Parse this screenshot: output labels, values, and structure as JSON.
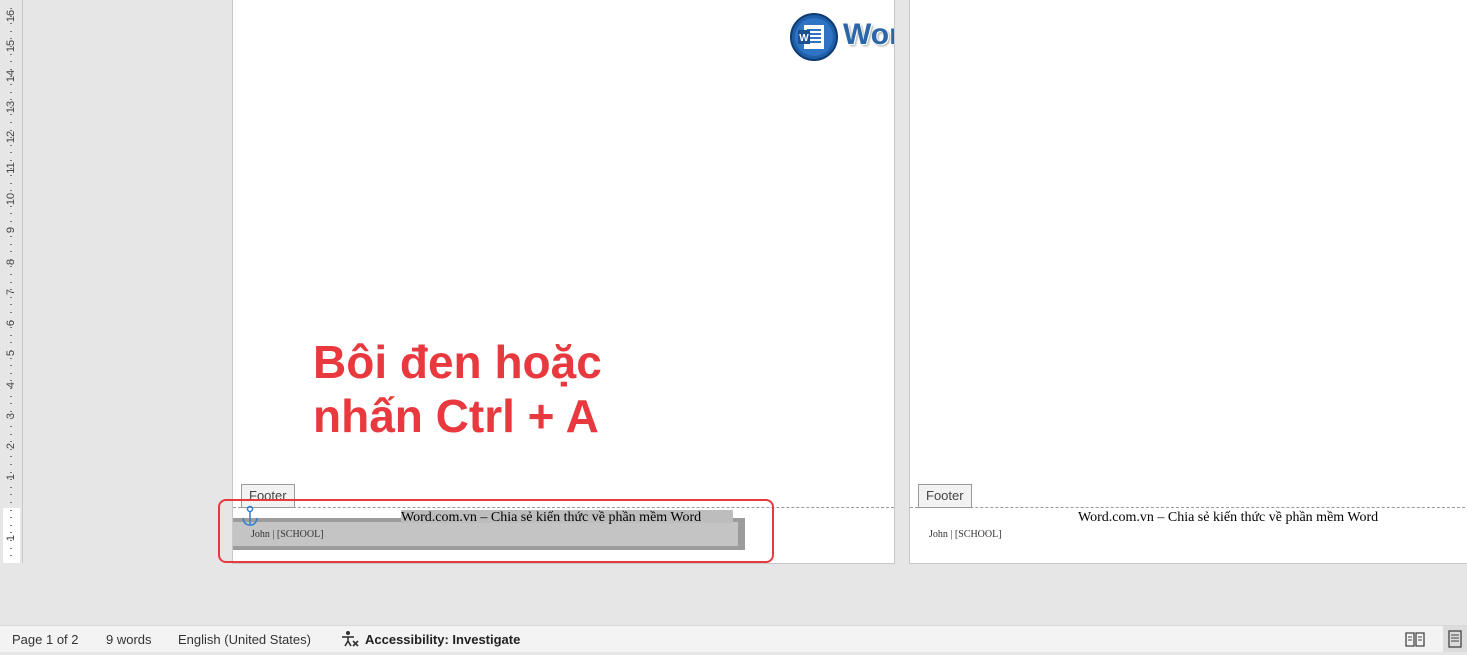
{
  "ruler": {
    "numbers": [
      "16",
      "15",
      "14",
      "13",
      "12",
      "11",
      "10",
      "9",
      "8",
      "7",
      "6",
      "5",
      "4",
      "3",
      "2",
      "1",
      "1"
    ]
  },
  "page1": {
    "footer_label": "Footer",
    "footer_text": "Word.com.vn – Chia sẻ kiến thức về phần mềm Word",
    "footer_name": "John | [SCHOOL]"
  },
  "page2": {
    "footer_label": "Footer",
    "footer_text": "Word.com.vn – Chia sẻ kiến thức về phần mềm Word",
    "footer_name": "John | [SCHOOL]"
  },
  "logo": {
    "text": "Word.com.vn"
  },
  "annotation": {
    "line1": "Bôi đen hoặc",
    "line2": "nhấn Ctrl + A"
  },
  "statusbar": {
    "page": "Page 1 of 2",
    "words": "9 words",
    "language": "English (United States)",
    "accessibility": "Accessibility: Investigate"
  },
  "icons": {
    "anchor": "anchor-icon",
    "accessibility": "accessibility-icon",
    "read_mode": "read-mode-icon",
    "print_layout": "print-layout-icon",
    "logo": "word-logo-icon"
  },
  "colors": {
    "annotation": "#e8393f",
    "logo_blue": "#2b66a8",
    "workspace": "#e6e6e6"
  }
}
